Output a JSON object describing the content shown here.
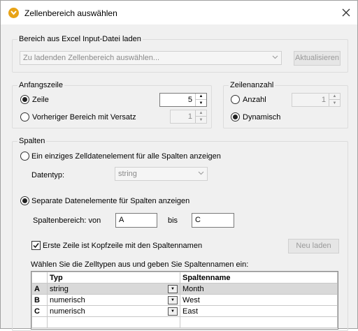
{
  "window": {
    "title": "Zellenbereich auswählen",
    "app_icon": "altova-icon",
    "close_icon": "close-icon"
  },
  "excel_group": {
    "legend": "Bereich aus Excel Input-Datei laden",
    "range_combo_placeholder": "Zu ladenden Zellenbereich auswählen...",
    "refresh_button": "Aktualisieren"
  },
  "start_row": {
    "legend": "Anfangszeile",
    "row_label": "Zeile",
    "row_value": "5",
    "previous_label": "Vorheriger Bereich mit Versatz",
    "previous_value": "1"
  },
  "row_count": {
    "legend": "Zeilenanzahl",
    "count_label": "Anzahl",
    "count_value": "1",
    "dynamic_label": "Dynamisch"
  },
  "columns": {
    "legend": "Spalten",
    "single_label": "Ein einziges Zelldatenelement für alle Spalten anzeigen",
    "datatype_label": "Datentyp:",
    "datatype_value": "string",
    "separate_label": "Separate Datenelemente für Spalten anzeigen",
    "range_label": "Spaltenbereich: von",
    "range_from": "A",
    "range_to_label": "bis",
    "range_to": "C",
    "header_checkbox_label": "Erste Zeile ist Kopfzeile mit den Spaltennamen",
    "reload_button": "Neu laden",
    "instruction": "Wählen Sie die Zelltypen aus und geben Sie Spaltennamen ein:",
    "table": {
      "headers": [
        "",
        "Typ",
        "Spaltenname"
      ],
      "rows": [
        {
          "col": "A",
          "type": "string",
          "name": "Month"
        },
        {
          "col": "B",
          "type": "numerisch",
          "name": "West"
        },
        {
          "col": "C",
          "type": "numerisch",
          "name": "East"
        }
      ]
    }
  },
  "colors": {
    "icon_accent": "#e8a316",
    "dialog_bg": "#f0f0f0",
    "selected_row": "#d9d9d9"
  }
}
